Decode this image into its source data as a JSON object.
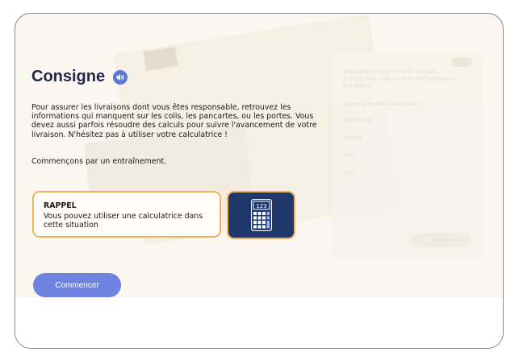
{
  "consigne": {
    "title": "Consigne",
    "sound_icon": "speaker-icon",
    "instructions": "Pour assurer les livraisons dont vous êtes responsable, retrouvez les informations qui manquent sur les colis, les pancartes, ou les portes. Vous devez aussi parfois résoudre des calculs pour suivre l'avancement de votre livraison. N'hésitez pas à utiliser votre calculatrice !",
    "start_text": "Commençons par un entraînement."
  },
  "reminder": {
    "title": "RAPPEL",
    "text": "Vous pouvez utiliser une calculatrice dans cette situation",
    "icon": "calculator-icon",
    "calculator_display": "123"
  },
  "start_button": {
    "label": "Commencer"
  },
  "background_panel": {
    "progress": "1/2",
    "question": "Vous devez livrer ce colis au parc d'attraction mais un mot est l'adresse a été effacé.",
    "ask": "Quel est le mot manquant ?",
    "options": [
      "Boulevard",
      "Rampe",
      "Port",
      "Cote"
    ],
    "submit_label": "Valider"
  },
  "colors": {
    "accent": "#6e84e0",
    "title": "#23284a",
    "reminder_border": "#f0b35c",
    "calculator_bg": "#20376b"
  }
}
